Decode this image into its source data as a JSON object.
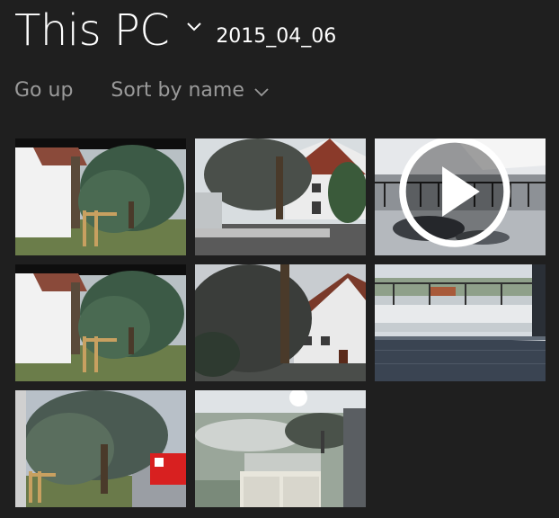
{
  "header": {
    "title": "This PC",
    "folder": "2015_04_06"
  },
  "toolbar": {
    "go_up_label": "Go up",
    "sort_label": "Sort by name"
  },
  "icons": {
    "title_chevron": "chevron-down-icon",
    "sort_chevron": "chevron-down-icon",
    "video_badge": "play-icon"
  },
  "colors": {
    "background": "#1f1f1f",
    "toolbar_text": "#9a9a9a",
    "title_text": "#ffffff"
  }
}
